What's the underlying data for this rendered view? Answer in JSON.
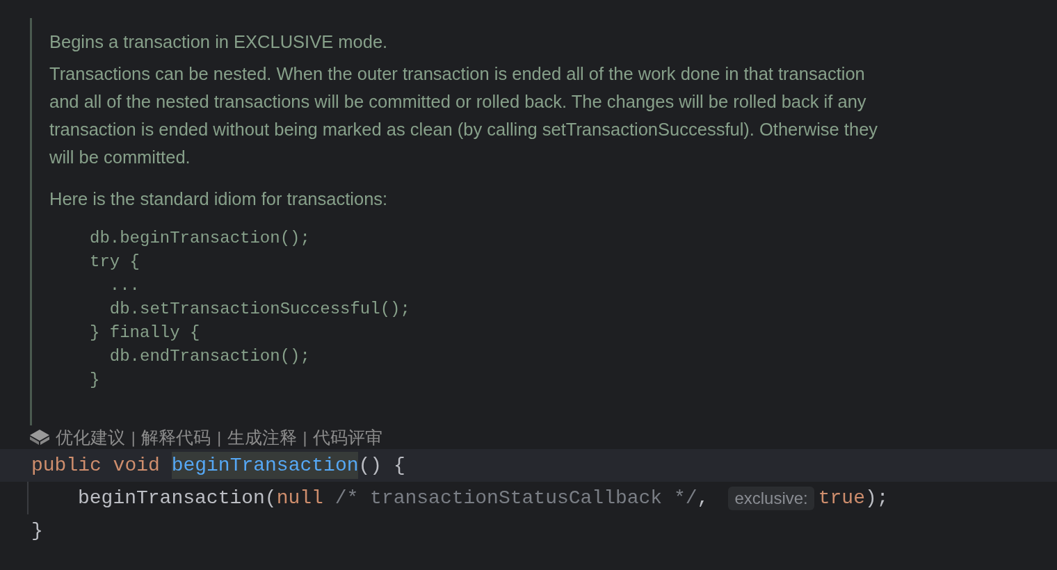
{
  "doc": {
    "paragraphs": [
      "Begins a transaction in EXCLUSIVE mode.",
      "Transactions can be nested. When the outer transaction is ended all of the work done in that transaction and all of the nested transactions will be committed or rolled back. The changes will be rolled back if any transaction is ended without being marked as clean (by calling setTransactionSuccessful). Otherwise they will be committed.",
      "Here is the standard idiom for transactions:"
    ],
    "code_lines": [
      "db.beginTransaction();",
      "try {",
      "  ...",
      "  db.setTransactionSuccessful();",
      "} finally {",
      "  db.endTransaction();",
      "}"
    ]
  },
  "ai_actions": [
    {
      "kind": "action",
      "label": "优化建议"
    },
    {
      "kind": "separator",
      "label": "|"
    },
    {
      "kind": "action",
      "label": "解释代码"
    },
    {
      "kind": "separator",
      "label": "|"
    },
    {
      "kind": "action",
      "label": "生成注释"
    },
    {
      "kind": "separator",
      "label": "|"
    },
    {
      "kind": "action",
      "label": "代码评审"
    }
  ],
  "editor_lines": [
    {
      "current": true,
      "indent": false,
      "tokens": [
        {
          "kind": "keyword",
          "text": "public void "
        },
        {
          "kind": "function",
          "text": "beginTransaction",
          "highlighted": true
        },
        {
          "kind": "plain",
          "text": "() {"
        }
      ]
    },
    {
      "current": false,
      "indent": true,
      "tokens": [
        {
          "kind": "plain",
          "text": "beginTransaction("
        },
        {
          "kind": "keyword",
          "text": "null"
        },
        {
          "kind": "comment",
          "text": " /* transactionStatusCallback */"
        },
        {
          "kind": "plain",
          "text": ","
        },
        {
          "kind": "hint",
          "text": "exclusive:"
        },
        {
          "kind": "keyword",
          "text": "true"
        },
        {
          "kind": "plain",
          "text": ");"
        }
      ]
    },
    {
      "current": false,
      "indent": false,
      "tokens": [
        {
          "kind": "plain",
          "text": "}"
        }
      ]
    }
  ]
}
